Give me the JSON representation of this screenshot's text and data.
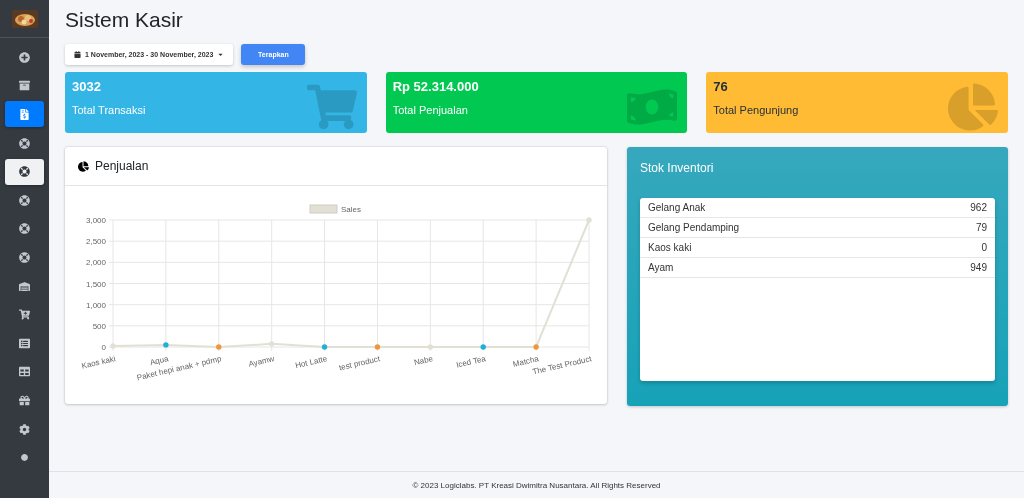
{
  "sidebar": {
    "items": [
      {
        "kind": "plus",
        "selected": false,
        "hovered": false
      },
      {
        "kind": "archive",
        "selected": false,
        "hovered": false
      },
      {
        "kind": "invoice",
        "selected": true,
        "hovered": false
      },
      {
        "kind": "lifering",
        "selected": false,
        "hovered": false
      },
      {
        "kind": "lifering",
        "selected": false,
        "hovered": true
      },
      {
        "kind": "lifering",
        "selected": false,
        "hovered": false
      },
      {
        "kind": "lifering",
        "selected": false,
        "hovered": false
      },
      {
        "kind": "lifering",
        "selected": false,
        "hovered": false
      },
      {
        "kind": "warehouse",
        "selected": false,
        "hovered": false
      },
      {
        "kind": "cart",
        "selected": false,
        "hovered": false
      },
      {
        "kind": "list",
        "selected": false,
        "hovered": false
      },
      {
        "kind": "table",
        "selected": false,
        "hovered": false
      },
      {
        "kind": "gift",
        "selected": false,
        "hovered": false
      },
      {
        "kind": "gear",
        "selected": false,
        "hovered": false
      },
      {
        "kind": "dot",
        "selected": false,
        "hovered": false
      }
    ]
  },
  "page_title": "Sistem Kasir",
  "filter": {
    "date_range": "1 November, 2023 - 30 November, 2023",
    "apply_button": "Terapkan"
  },
  "stat_cards": [
    {
      "value": "3032",
      "label": "Total Transaksi",
      "kind": "cart",
      "color": "#33b5e5"
    },
    {
      "value": "Rp 52.314.000",
      "label": "Total Penjualan",
      "kind": "money",
      "color": "#00c851"
    },
    {
      "value": "76",
      "label": "Total Pengunjung",
      "kind": "pie",
      "color": "#ffbb33"
    }
  ],
  "sales_panel": {
    "title": "Penjualan",
    "chart_data": {
      "type": "line",
      "categories": [
        "Kaos kaki",
        "Aqua",
        "Paket hepi anak + pdmp",
        "Ayamw",
        "Hot Latte",
        "test product",
        "Nabe",
        "Iced Tea",
        "Matcha",
        "The Test Product"
      ],
      "series": [
        {
          "name": "Sales",
          "color": "#e2e0d4",
          "values": [
            25,
            50,
            0,
            75,
            0,
            0,
            0,
            0,
            0,
            3000
          ]
        }
      ],
      "grid": true,
      "ylim": [
        0,
        3000
      ],
      "yticks": [
        {
          "value": 0,
          "label": "0"
        },
        {
          "value": 500,
          "label": "500"
        },
        {
          "value": 1000,
          "label": "1,000"
        },
        {
          "value": 1500,
          "label": "1,500"
        },
        {
          "value": 2000,
          "label": "2,000"
        },
        {
          "value": 2500,
          "label": "2,500"
        },
        {
          "value": 3000,
          "label": "3,000"
        }
      ]
    }
  },
  "inventory_panel": {
    "title": "Stok Inventori",
    "items": [
      {
        "name": "Gelang Anak",
        "stock": "962"
      },
      {
        "name": "Gelang Pendamping",
        "stock": "79"
      },
      {
        "name": "Kaos kaki",
        "stock": "0"
      },
      {
        "name": "Ayam",
        "stock": "949"
      }
    ]
  },
  "footer": "© 2023 Logiclabs. PT Kreasi Dwimitra Nusantara. All Rights Reserved"
}
